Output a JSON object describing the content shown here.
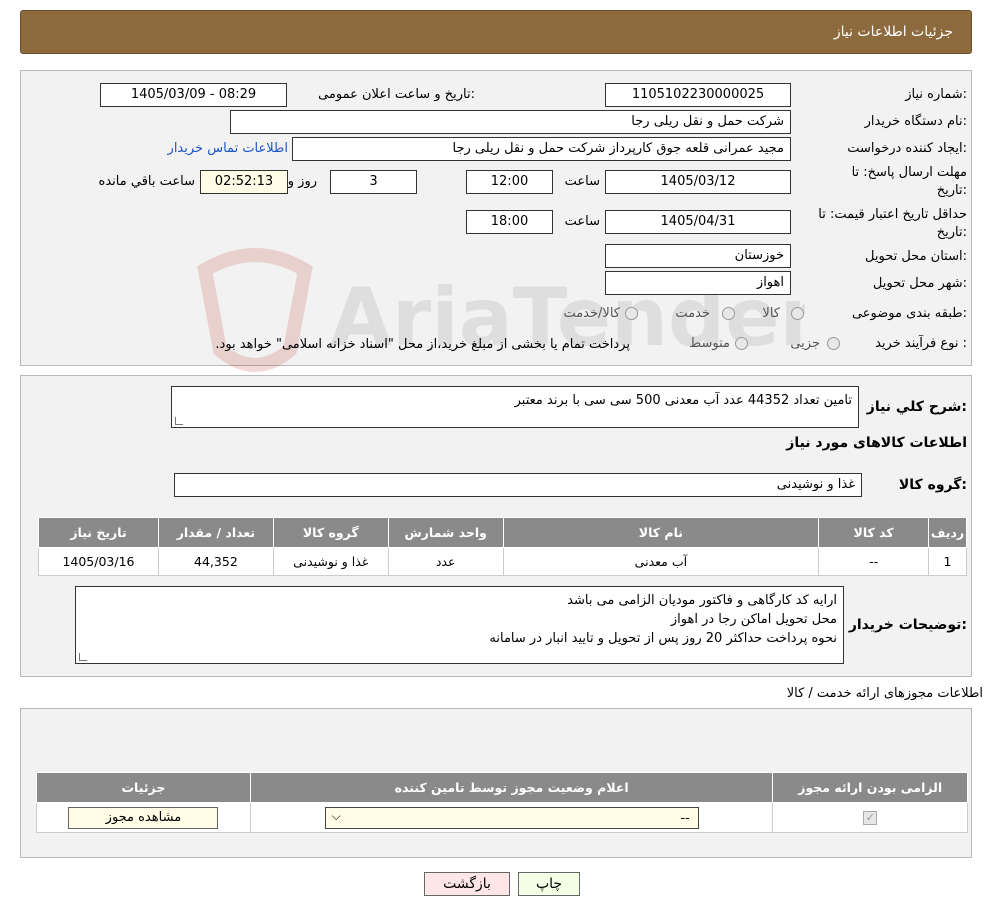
{
  "header": {
    "title": "جزئیات اطلاعات نیاز"
  },
  "watermark": {
    "text": "AriaTender.neT"
  },
  "form": {
    "need_number": {
      "label": "شماره نیاز:",
      "value": "1105102230000025"
    },
    "announce_datetime": {
      "label": "تاریخ و ساعت اعلان عمومی:",
      "value": "1405/03/09 - 08:29"
    },
    "buyer_org": {
      "label": "نام دستگاه خریدار:",
      "value": "شرکت حمل و نقل ریلی رجا"
    },
    "requester": {
      "label": "ایجاد کننده درخواست:",
      "value": "مجید عمرانی قلعه جوق کارپرداز شرکت حمل و نقل ریلی رجا",
      "contact_link": "اطلاعات تماس خریدار"
    },
    "reply_deadline": {
      "label_line1": "مهلت ارسال پاسخ: تا",
      "label_line2": "تاریخ:",
      "date": "1405/03/12",
      "time_label": "ساعت",
      "time": "12:00",
      "days": "3",
      "days_label": "روز و",
      "remaining": "02:52:13",
      "remaining_label": "ساعت باقي مانده"
    },
    "price_validity": {
      "label_line1": "حداقل تاریخ اعتبار قیمت: تا",
      "label_line2": "تاریخ:",
      "date": "1405/04/31",
      "time_label": "ساعت",
      "time": "18:00"
    },
    "province": {
      "label": "استان محل تحویل:",
      "value": "خوزستان"
    },
    "city": {
      "label": "شهر محل تحویل:",
      "value": "اهواز"
    },
    "category": {
      "label": "طبقه بندی موضوعی:",
      "options": [
        "کالا",
        "خدمت",
        "کالا/خدمت"
      ]
    },
    "purchase_type": {
      "label": "نوع فرآیند خرید :",
      "options": [
        "جزیی",
        "متوسط"
      ],
      "note": "پرداخت تمام یا بخشی از مبلغ خرید،از محل \"اسناد خزانه اسلامی\" خواهد بود."
    }
  },
  "summary": {
    "label": "شرح کلي نیاز:",
    "value": "تامین تعداد 44352 عدد آب معدنی 500 سی سی با برند معتبر",
    "goods_info_title": "اطلاعات کالاهای مورد نیاز",
    "goods_group_label": "گروه کالا:",
    "goods_group_value": "غذا و نوشیدنی"
  },
  "goods_table": {
    "columns": [
      "ردیف",
      "کد کالا",
      "نام کالا",
      "واحد شمارش",
      "گروه کالا",
      "تعداد / مقدار",
      "تاریخ نیاز"
    ],
    "rows": [
      [
        "1",
        "--",
        "آب معدنی",
        "عدد",
        "غذا و نوشیدنی",
        "44,352",
        "1405/03/16"
      ]
    ]
  },
  "buyer_notes": {
    "label": "توضیحات خریدار:",
    "lines": [
      "ارایه کد کارگاهی و فاکتور مودیان الزامی می باشد",
      "محل تحویل اماکن رجا در اهواز",
      "نحوه پرداخت حداکثر 20 روز پس از تحویل و تایید انبار در سامانه"
    ]
  },
  "permits": {
    "title": "اطلاعات مجوزهای ارائه خدمت / کالا",
    "columns": [
      "الزامی بودن ارائه مجوز",
      "اعلام وضعیت مجوز توسط تامین کننده",
      "جزئیات"
    ],
    "select_value": "--",
    "view_button": "مشاهده مجوز"
  },
  "buttons": {
    "print": "چاپ",
    "back": "بازگشت"
  }
}
